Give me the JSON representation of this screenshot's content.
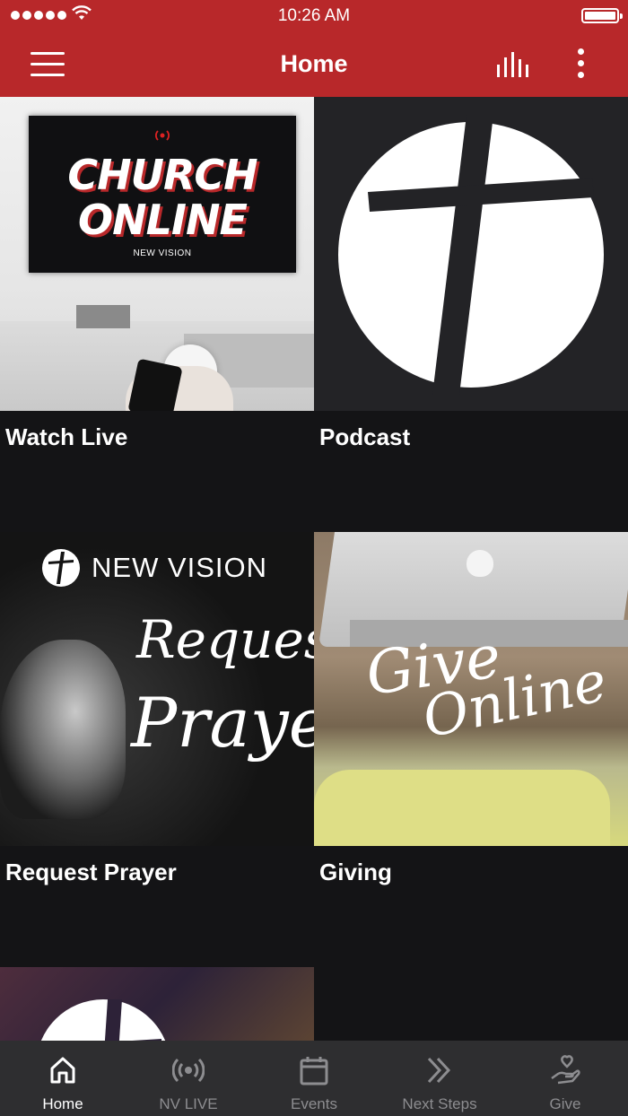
{
  "status_bar": {
    "time": "10:26 AM"
  },
  "header": {
    "title": "Home",
    "menu_icon": "hamburger-icon",
    "stats_icon": "bar-chart-icon",
    "more_icon": "more-vertical-icon",
    "background": "#b8282a"
  },
  "tiles": [
    {
      "label": "Watch Live",
      "image_text": {
        "line1": "CHURCH",
        "line2": "ONLINE",
        "sub": "NEW VISION"
      }
    },
    {
      "label": "Podcast"
    },
    {
      "label": "Request Prayer",
      "image_text": {
        "brand": "NEW VISION",
        "line1": "Request",
        "line2": "Prayer"
      }
    },
    {
      "label": "Giving",
      "image_text": {
        "line1": "Give",
        "line2": "Online"
      }
    },
    {
      "label": ""
    }
  ],
  "tabbar": {
    "items": [
      {
        "label": "Home",
        "icon": "home-icon",
        "active": true
      },
      {
        "label": "NV LIVE",
        "icon": "broadcast-icon",
        "active": false
      },
      {
        "label": "Events",
        "icon": "calendar-icon",
        "active": false
      },
      {
        "label": "Next Steps",
        "icon": "double-chevron-right-icon",
        "active": false
      },
      {
        "label": "Give",
        "icon": "heart-hand-icon",
        "active": false
      }
    ]
  }
}
